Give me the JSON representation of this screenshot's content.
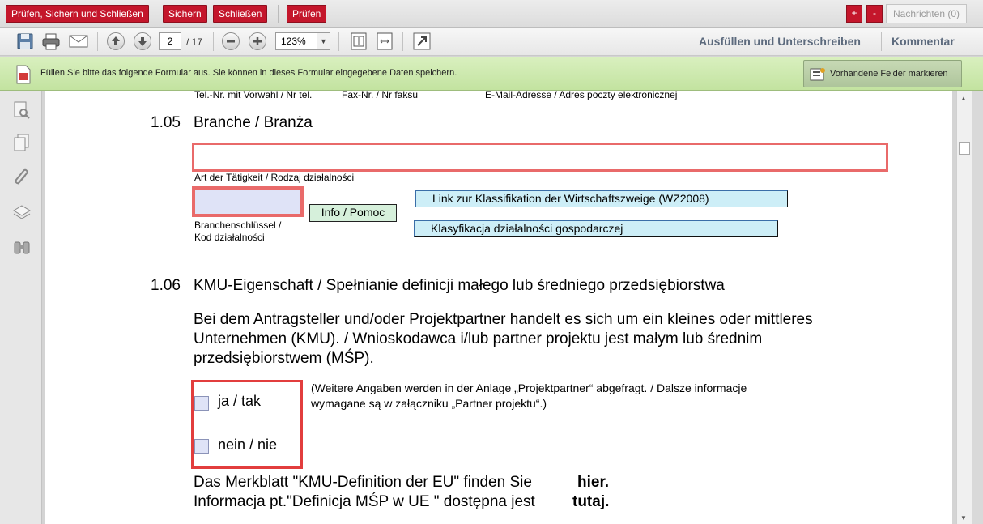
{
  "topbar": {
    "check_save_close": "Prüfen, Sichern und Schließen",
    "save": "Sichern",
    "close": "Schließen",
    "check": "Prüfen",
    "plus": "+",
    "minus": "-",
    "messages": "Nachrichten (0)"
  },
  "toolbar": {
    "page_current": "2",
    "page_total": "/ 17",
    "zoom": "123%",
    "fill_sign": "Ausfüllen und Unterschreiben",
    "comment": "Kommentar"
  },
  "infobar": {
    "text": "Füllen Sie bitte das folgende Formular aus. Sie können in dieses Formular eingegebene Daten speichern.",
    "highlight_button": "Vorhandene Felder markieren"
  },
  "document": {
    "header_tel": "Tel.-Nr. mit Vorwahl / Nr tel.",
    "header_fax": "Fax-Nr. / Nr faksu",
    "header_email": "E-Mail-Adresse / Adres poczty elektronicznej",
    "s105_num": "1.05",
    "s105_title": "Branche / Branża",
    "activity_label": "Art der Tätigkeit / Rodzaj działalności",
    "code_label_1": "Branchenschlüssel /",
    "code_label_2": "Kod działalności",
    "info_button": "Info / Pomoc",
    "link_wz": "Link zur Klassifikation der Wirtschaftszweige (WZ2008)",
    "link_pl": "Klasyfikacja działalności gospodarczej",
    "s106_num": "1.06",
    "s106_title": "KMU-Eigenschaft / Spełnianie definicji małego lub średniego przedsiębiorstwa",
    "para_line1": "Bei dem Antragsteller und/oder Projektpartner handelt es sich um ein kleines oder mittleres",
    "para_line2": "Unternehmen (KMU). / Wnioskodawca i/lub partner projektu jest małym lub średnim",
    "para_line3": "przedsiębiorstwem (MŚP).",
    "opt_yes": "ja / tak",
    "opt_no": "nein / nie",
    "note_line1": "(Weitere Angaben werden in der Anlage „Projektpartner“ abgefragt. / Dalsze informacje",
    "note_line2": "wymagane są w załączniku „Partner projektu“.)",
    "merkblatt": "Das Merkblatt \"KMU-Definition der EU\" finden Sie",
    "merkblatt_link": "hier.",
    "informacja": "Informacja pt.\"Definicja MŚP w UE \" dostępna jest",
    "informacja_link": "tutaj."
  }
}
